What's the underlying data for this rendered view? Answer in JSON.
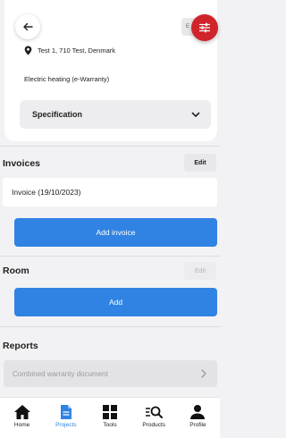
{
  "header": {
    "edit_label": "E",
    "address": "Test 1, 710 Test, Denmark",
    "product": "Electric heating (e-Warranty)",
    "specification_label": "Specification"
  },
  "invoices": {
    "title": "Invoices",
    "edit_label": "Edit",
    "items": [
      "Invoice (19/10/2023)"
    ],
    "add_label": "Add invoice"
  },
  "room": {
    "title": "Room",
    "edit_label": "Edit",
    "add_label": "Add"
  },
  "reports": {
    "title": "Reports",
    "items": [
      "Combined warranty document"
    ]
  },
  "nav": {
    "items": [
      {
        "label": "Home",
        "icon": "home-icon"
      },
      {
        "label": "Projects",
        "icon": "document-icon",
        "active": true
      },
      {
        "label": "Tools",
        "icon": "grid-icon"
      },
      {
        "label": "Products",
        "icon": "search-list-icon"
      },
      {
        "label": "Profile",
        "icon": "person-icon"
      }
    ]
  },
  "colors": {
    "primary": "#3083e3",
    "fab": "#d0242b",
    "background": "#f2f2f4"
  }
}
